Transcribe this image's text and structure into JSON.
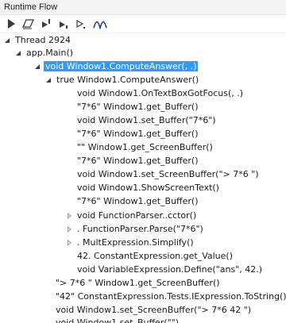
{
  "window": {
    "title": "Runtime Flow"
  },
  "toolbar": {
    "buttons": [
      {
        "name": "run-icon"
      },
      {
        "name": "clear-icon"
      },
      {
        "name": "step-over-icon"
      },
      {
        "name": "step-into-icon"
      },
      {
        "name": "step-out-icon"
      },
      {
        "name": "flow-icon"
      }
    ]
  },
  "tree": {
    "selected_index": 3,
    "rows": [
      {
        "label": "Thread 2924",
        "expander": "open"
      },
      {
        "label": "app.Main()",
        "expander": "open"
      },
      {
        "label": "void Window1.ComputeAnswer(, .)",
        "expander": "open"
      },
      {
        "label": "true Window1.ComputeAnswer()",
        "expander": "open"
      },
      {
        "label": "void Window1.OnTextBoxGotFocus(, .)",
        "expander": "none"
      },
      {
        "label": "\"7*6\" Window1.get_Buffer()",
        "expander": "none"
      },
      {
        "label": "void Window1.set_Buffer(\"7*6\")",
        "expander": "none"
      },
      {
        "label": "\"7*6\" Window1.get_Buffer()",
        "expander": "none"
      },
      {
        "label": "\"\" Window1.get_ScreenBuffer()",
        "expander": "none"
      },
      {
        "label": "\"7*6\" Window1.get_Buffer()",
        "expander": "none"
      },
      {
        "label": "void Window1.set_ScreenBuffer(\"> 7*6 \")",
        "expander": "none"
      },
      {
        "label": "void Window1.ShowScreenText()",
        "expander": "none"
      },
      {
        "label": "\"7*6\" Window1.get_Buffer()",
        "expander": "none"
      },
      {
        "label": "void FunctionParser..cctor()",
        "expander": "closed"
      },
      {
        "label": ". FunctionParser.Parse(\"7*6\")",
        "expander": "closed"
      },
      {
        "label": ". MultExpression.Simplify()",
        "expander": "closed"
      },
      {
        "label": "42. ConstantExpression.get_Value()",
        "expander": "none"
      },
      {
        "label": "void VariableExpression.Define(\"ans\", 42.)",
        "expander": "none"
      },
      {
        "label": "\"> 7*6 \" Window1.get_ScreenBuffer()",
        "expander": "none"
      },
      {
        "label": "\"42\" ConstantExpression.Tests.IExpression.ToString()",
        "expander": "none"
      },
      {
        "label": "void Window1.set_ScreenBuffer(\"> 7*6 42 \")",
        "expander": "none"
      },
      {
        "label": "void Window1.set_Buffer(\"\")",
        "expander": "none"
      }
    ]
  }
}
